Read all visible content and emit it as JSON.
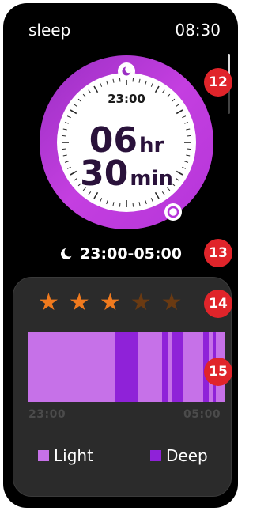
{
  "header": {
    "app_title": "sleep",
    "time": "08:30"
  },
  "dial": {
    "bedtime_label": "23:00",
    "hours": "06",
    "hours_unit": "hr",
    "minutes": "30",
    "minutes_unit": "min",
    "ring_color": "#c43fe0",
    "start_icon": "moon-icon",
    "end_icon": "alarm-dot-icon"
  },
  "range": {
    "icon": "moon-icon",
    "text": "23:00-05:00"
  },
  "rating": {
    "filled": 3,
    "total": 5
  },
  "stages": {
    "start_label": "23:00",
    "end_label": "05:00",
    "light_color": "#c671e8",
    "deep_color": "#8f22d8",
    "deep_segments": [
      {
        "start": 0.44,
        "end": 0.56
      },
      {
        "start": 0.68,
        "end": 0.71
      },
      {
        "start": 0.73,
        "end": 0.79
      },
      {
        "start": 0.89,
        "end": 0.92
      },
      {
        "start": 0.94,
        "end": 0.955
      }
    ]
  },
  "legend": {
    "light_label": "Light",
    "deep_label": "Deep"
  },
  "badges": [
    "12",
    "13",
    "14",
    "15"
  ]
}
